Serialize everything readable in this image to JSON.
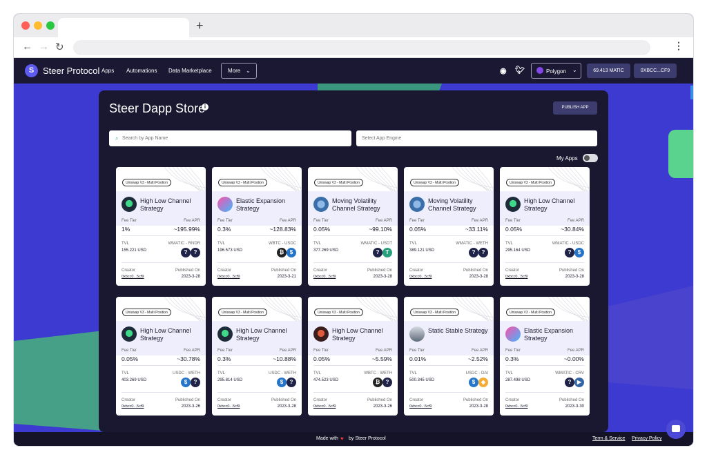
{
  "topnav": {
    "brand": "Steer Protocol",
    "links": [
      "Apps",
      "Automations",
      "Data Marketplace"
    ],
    "more_label": "More",
    "network_label": "Polygon",
    "balance": "69.413 MATIC",
    "wallet": "0XBCC...CF9"
  },
  "store": {
    "title": "Steer Dapp Store",
    "publish_label": "PUBLISH APP",
    "search_placeholder": "Search by App Name",
    "engine_placeholder": "Select App Engine",
    "my_apps_label": "My Apps"
  },
  "labels": {
    "fee_tier": "Fee Tier",
    "fee_apr": "Fee APR",
    "tvl": "TVL",
    "creator": "Creator",
    "published_on": "Published On"
  },
  "cards": [
    {
      "engine": "Uniswap V3 - Multi Position",
      "name": "High Low Channel Strategy",
      "icon": "high-low-icon",
      "fee_tier": "1%",
      "fee_apr": "~195.99%",
      "tvl": "155.221 USD",
      "pair": "WMATIC - RNDR",
      "tokens": [
        "unknown-token-icon",
        "unknown-token-icon"
      ],
      "creator": "0xbcc0...5cf9",
      "published": "2023-3-28"
    },
    {
      "engine": "Uniswap V3 - Multi Position",
      "name": "Elastic Expansion Strategy",
      "icon": "elastic-icon",
      "fee_tier": "0.3%",
      "fee_apr": "~128.83%",
      "tvl": "196.573 USD",
      "pair": "WBTC - USDC",
      "tokens": [
        "btc-token-icon",
        "usdc-token-icon"
      ],
      "creator": "0xbcc0...5cf9",
      "published": "2023-3-21"
    },
    {
      "engine": "Uniswap V3 - Multi Position",
      "name": "Moving Volatility Channel Strategy",
      "icon": "moving-volatility-icon",
      "fee_tier": "0.05%",
      "fee_apr": "~99.10%",
      "tvl": "377.269 USD",
      "pair": "WMATIC - USDT",
      "tokens": [
        "unknown-token-icon",
        "usdt-token-icon"
      ],
      "creator": "0xbcc0...5cf9",
      "published": "2023-3-28"
    },
    {
      "engine": "Uniswap V3 - Multi Position",
      "name": "Moving Volatility Channel Strategy",
      "icon": "moving-volatility-icon",
      "fee_tier": "0.05%",
      "fee_apr": "~33.11%",
      "tvl": "389.121 USD",
      "pair": "WMATIC - WETH",
      "tokens": [
        "unknown-token-icon",
        "unknown-token-icon"
      ],
      "creator": "0xbcc0...5cf9",
      "published": "2023-3-28"
    },
    {
      "engine": "Uniswap V3 - Multi Position",
      "name": "High Low Channel Strategy",
      "icon": "high-low-icon",
      "fee_tier": "0.05%",
      "fee_apr": "~30.84%",
      "tvl": "295.164 USD",
      "pair": "WMATIC - USDC",
      "tokens": [
        "unknown-token-icon",
        "usdc-token-icon"
      ],
      "creator": "0xbcc0...5cf9",
      "published": "2023-3-28"
    },
    {
      "engine": "Uniswap V3 - Multi Position",
      "name": "High Low Channel Strategy",
      "icon": "high-low-icon",
      "fee_tier": "0.05%",
      "fee_apr": "~30.78%",
      "tvl": "403.269 USD",
      "pair": "USDC - WETH",
      "tokens": [
        "usdc-token-icon",
        "unknown-token-icon"
      ],
      "creator": "0xbcc0...5cf9",
      "published": "2023-3-26"
    },
    {
      "engine": "Uniswap V3 - Multi Position",
      "name": "High Low Channel Strategy",
      "icon": "high-low-icon",
      "fee_tier": "0.3%",
      "fee_apr": "~10.88%",
      "tvl": "295.814 USD",
      "pair": "USDC - WETH",
      "tokens": [
        "usdc-token-icon",
        "unknown-token-icon"
      ],
      "creator": "0xbcc0...5cf9",
      "published": "2023-3-28"
    },
    {
      "engine": "Uniswap V3 - Multi Position",
      "name": "High Low Channel Strategy",
      "icon": "high-low-red-icon",
      "fee_tier": "0.05%",
      "fee_apr": "~5.59%",
      "tvl": "474.523 USD",
      "pair": "WBTC - WETH",
      "tokens": [
        "btc-token-icon",
        "unknown-token-icon"
      ],
      "creator": "0xbcc0...5cf9",
      "published": "2023-3-26"
    },
    {
      "engine": "Uniswap V3 - Multi Position",
      "name": "Static Stable Strategy",
      "icon": "static-stable-icon",
      "fee_tier": "0.01%",
      "fee_apr": "~2.52%",
      "tvl": "500.345 USD",
      "pair": "USDC - DAI",
      "tokens": [
        "usdc-token-icon",
        "dai-token-icon"
      ],
      "creator": "0xbcc0...5cf9",
      "published": "2023-3-28"
    },
    {
      "engine": "Uniswap V3 - Multi Position",
      "name": "Elastic Expansion Strategy",
      "icon": "elastic-icon",
      "fee_tier": "0.3%",
      "fee_apr": "~0.00%",
      "tvl": "287.498 USD",
      "pair": "WMATIC - CRV",
      "tokens": [
        "unknown-token-icon",
        "crv-token-icon"
      ],
      "creator": "0xbcc0...5cf9",
      "published": "2023-3-30"
    }
  ],
  "footer": {
    "made_with": "Made with",
    "by": "by Steer Protocol",
    "terms": "Term & Service",
    "privacy": "Privacy Policy"
  }
}
